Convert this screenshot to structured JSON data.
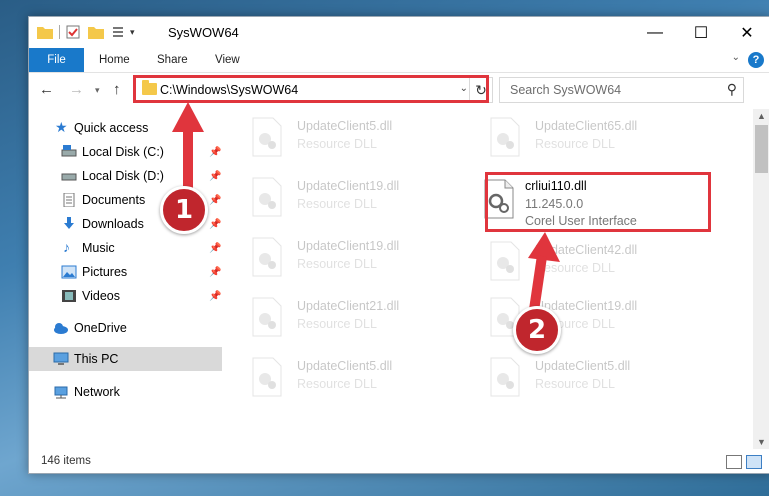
{
  "window": {
    "title": "SysWOW64",
    "controls": {
      "minimize": "—",
      "maximize": "☐",
      "close": "✕"
    }
  },
  "ribbon": {
    "file": "File",
    "tabs": [
      "Home",
      "Share",
      "View"
    ],
    "help": "?"
  },
  "address": {
    "path": "C:\\Windows\\SysWOW64",
    "search_placeholder": "Search SysWOW64"
  },
  "nav": {
    "quick_access": "Quick access",
    "items": [
      {
        "label": "Local Disk (C:)",
        "icon": "drive-icon",
        "pinned": true
      },
      {
        "label": "Local Disk (D:)",
        "icon": "drive-icon",
        "pinned": true
      },
      {
        "label": "Documents",
        "icon": "documents-icon",
        "pinned": true
      },
      {
        "label": "Downloads",
        "icon": "downloads-icon",
        "pinned": true
      },
      {
        "label": "Music",
        "icon": "music-icon",
        "pinned": true
      },
      {
        "label": "Pictures",
        "icon": "pictures-icon",
        "pinned": true
      },
      {
        "label": "Videos",
        "icon": "videos-icon",
        "pinned": true
      }
    ],
    "onedrive": "OneDrive",
    "this_pc": "This PC",
    "network": "Network"
  },
  "files": [
    {
      "name": "UpdateClient5.dll",
      "sub": "Resource DLL"
    },
    {
      "name": "UpdateClient65.dll",
      "sub": "Resource DLL"
    },
    {
      "name": "UpdateClient19.dll",
      "sub": "Resource DLL"
    },
    {
      "name": "crliui110.dll",
      "sub": "11.245.0.0",
      "sub2": "Corel User Interface"
    },
    {
      "name": "UpdateClient19.dll",
      "sub": "Resource DLL"
    },
    {
      "name": "UpdateClient42.dll",
      "sub": "Resource DLL"
    },
    {
      "name": "UpdateClient21.dll",
      "sub": "Resource DLL"
    },
    {
      "name": "UpdateClient19.dll",
      "sub": "Resource DLL"
    },
    {
      "name": "UpdateClient5.dll",
      "sub": "Resource DLL"
    },
    {
      "name": "UpdateClient5.dll",
      "sub": "Resource DLL"
    }
  ],
  "status": {
    "items": "146 items"
  },
  "annotations": {
    "step1": "1",
    "step2": "2",
    "color": "#e0353d"
  }
}
